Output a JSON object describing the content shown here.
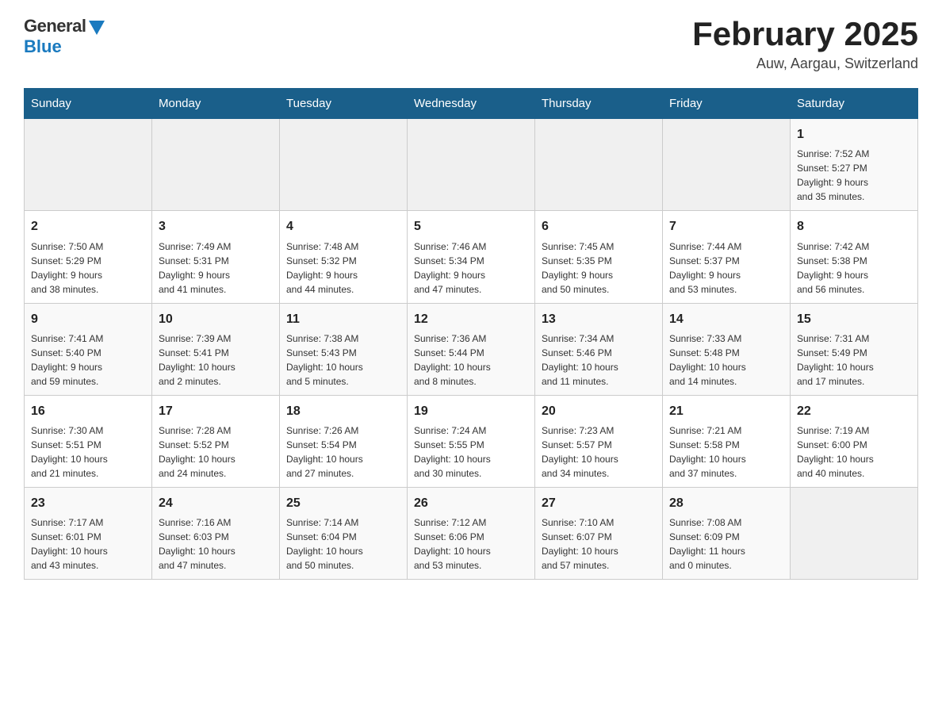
{
  "header": {
    "logo_general": "General",
    "logo_blue": "Blue",
    "title": "February 2025",
    "subtitle": "Auw, Aargau, Switzerland"
  },
  "calendar": {
    "days_of_week": [
      "Sunday",
      "Monday",
      "Tuesday",
      "Wednesday",
      "Thursday",
      "Friday",
      "Saturday"
    ],
    "weeks": [
      [
        {
          "day": "",
          "info": ""
        },
        {
          "day": "",
          "info": ""
        },
        {
          "day": "",
          "info": ""
        },
        {
          "day": "",
          "info": ""
        },
        {
          "day": "",
          "info": ""
        },
        {
          "day": "",
          "info": ""
        },
        {
          "day": "1",
          "info": "Sunrise: 7:52 AM\nSunset: 5:27 PM\nDaylight: 9 hours\nand 35 minutes."
        }
      ],
      [
        {
          "day": "2",
          "info": "Sunrise: 7:50 AM\nSunset: 5:29 PM\nDaylight: 9 hours\nand 38 minutes."
        },
        {
          "day": "3",
          "info": "Sunrise: 7:49 AM\nSunset: 5:31 PM\nDaylight: 9 hours\nand 41 minutes."
        },
        {
          "day": "4",
          "info": "Sunrise: 7:48 AM\nSunset: 5:32 PM\nDaylight: 9 hours\nand 44 minutes."
        },
        {
          "day": "5",
          "info": "Sunrise: 7:46 AM\nSunset: 5:34 PM\nDaylight: 9 hours\nand 47 minutes."
        },
        {
          "day": "6",
          "info": "Sunrise: 7:45 AM\nSunset: 5:35 PM\nDaylight: 9 hours\nand 50 minutes."
        },
        {
          "day": "7",
          "info": "Sunrise: 7:44 AM\nSunset: 5:37 PM\nDaylight: 9 hours\nand 53 minutes."
        },
        {
          "day": "8",
          "info": "Sunrise: 7:42 AM\nSunset: 5:38 PM\nDaylight: 9 hours\nand 56 minutes."
        }
      ],
      [
        {
          "day": "9",
          "info": "Sunrise: 7:41 AM\nSunset: 5:40 PM\nDaylight: 9 hours\nand 59 minutes."
        },
        {
          "day": "10",
          "info": "Sunrise: 7:39 AM\nSunset: 5:41 PM\nDaylight: 10 hours\nand 2 minutes."
        },
        {
          "day": "11",
          "info": "Sunrise: 7:38 AM\nSunset: 5:43 PM\nDaylight: 10 hours\nand 5 minutes."
        },
        {
          "day": "12",
          "info": "Sunrise: 7:36 AM\nSunset: 5:44 PM\nDaylight: 10 hours\nand 8 minutes."
        },
        {
          "day": "13",
          "info": "Sunrise: 7:34 AM\nSunset: 5:46 PM\nDaylight: 10 hours\nand 11 minutes."
        },
        {
          "day": "14",
          "info": "Sunrise: 7:33 AM\nSunset: 5:48 PM\nDaylight: 10 hours\nand 14 minutes."
        },
        {
          "day": "15",
          "info": "Sunrise: 7:31 AM\nSunset: 5:49 PM\nDaylight: 10 hours\nand 17 minutes."
        }
      ],
      [
        {
          "day": "16",
          "info": "Sunrise: 7:30 AM\nSunset: 5:51 PM\nDaylight: 10 hours\nand 21 minutes."
        },
        {
          "day": "17",
          "info": "Sunrise: 7:28 AM\nSunset: 5:52 PM\nDaylight: 10 hours\nand 24 minutes."
        },
        {
          "day": "18",
          "info": "Sunrise: 7:26 AM\nSunset: 5:54 PM\nDaylight: 10 hours\nand 27 minutes."
        },
        {
          "day": "19",
          "info": "Sunrise: 7:24 AM\nSunset: 5:55 PM\nDaylight: 10 hours\nand 30 minutes."
        },
        {
          "day": "20",
          "info": "Sunrise: 7:23 AM\nSunset: 5:57 PM\nDaylight: 10 hours\nand 34 minutes."
        },
        {
          "day": "21",
          "info": "Sunrise: 7:21 AM\nSunset: 5:58 PM\nDaylight: 10 hours\nand 37 minutes."
        },
        {
          "day": "22",
          "info": "Sunrise: 7:19 AM\nSunset: 6:00 PM\nDaylight: 10 hours\nand 40 minutes."
        }
      ],
      [
        {
          "day": "23",
          "info": "Sunrise: 7:17 AM\nSunset: 6:01 PM\nDaylight: 10 hours\nand 43 minutes."
        },
        {
          "day": "24",
          "info": "Sunrise: 7:16 AM\nSunset: 6:03 PM\nDaylight: 10 hours\nand 47 minutes."
        },
        {
          "day": "25",
          "info": "Sunrise: 7:14 AM\nSunset: 6:04 PM\nDaylight: 10 hours\nand 50 minutes."
        },
        {
          "day": "26",
          "info": "Sunrise: 7:12 AM\nSunset: 6:06 PM\nDaylight: 10 hours\nand 53 minutes."
        },
        {
          "day": "27",
          "info": "Sunrise: 7:10 AM\nSunset: 6:07 PM\nDaylight: 10 hours\nand 57 minutes."
        },
        {
          "day": "28",
          "info": "Sunrise: 7:08 AM\nSunset: 6:09 PM\nDaylight: 11 hours\nand 0 minutes."
        },
        {
          "day": "",
          "info": ""
        }
      ]
    ]
  }
}
